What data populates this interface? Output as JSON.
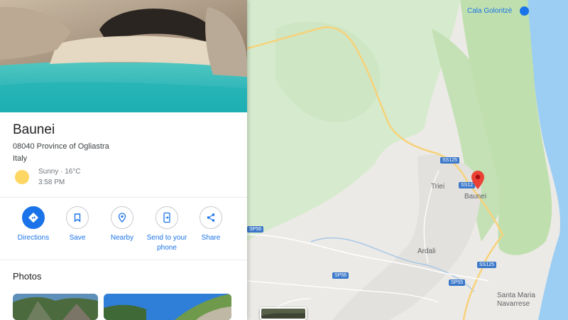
{
  "place": {
    "name": "Baunei",
    "address_line1": "08040 Province of Ogliastra",
    "address_line2": "Italy",
    "weather": "Sunny · 16°C",
    "time": "3:58 PM"
  },
  "actions": [
    {
      "label": "Directions",
      "icon": "directions-icon"
    },
    {
      "label": "Save",
      "icon": "bookmark-icon"
    },
    {
      "label": "Nearby",
      "icon": "nearby-icon"
    },
    {
      "label": "Send to your phone",
      "icon": "phone-icon"
    },
    {
      "label": "Share",
      "icon": "share-icon"
    }
  ],
  "photos": {
    "title": "Photos"
  },
  "map": {
    "poi": "Cala Goloritzè",
    "towns": [
      "Triei",
      "Baunei",
      "Ardali",
      "Santa Maria Navarrese"
    ],
    "roads": [
      "SS125",
      "SS12",
      "SS125",
      "SP56",
      "SP56",
      "SP55"
    ],
    "colors": {
      "water": "#9ccdf2",
      "land": "#eceae6",
      "park": "#c9e6bf",
      "road": "#f7d27a",
      "accent": "#1a73e8",
      "pin": "#ea4335"
    }
  }
}
